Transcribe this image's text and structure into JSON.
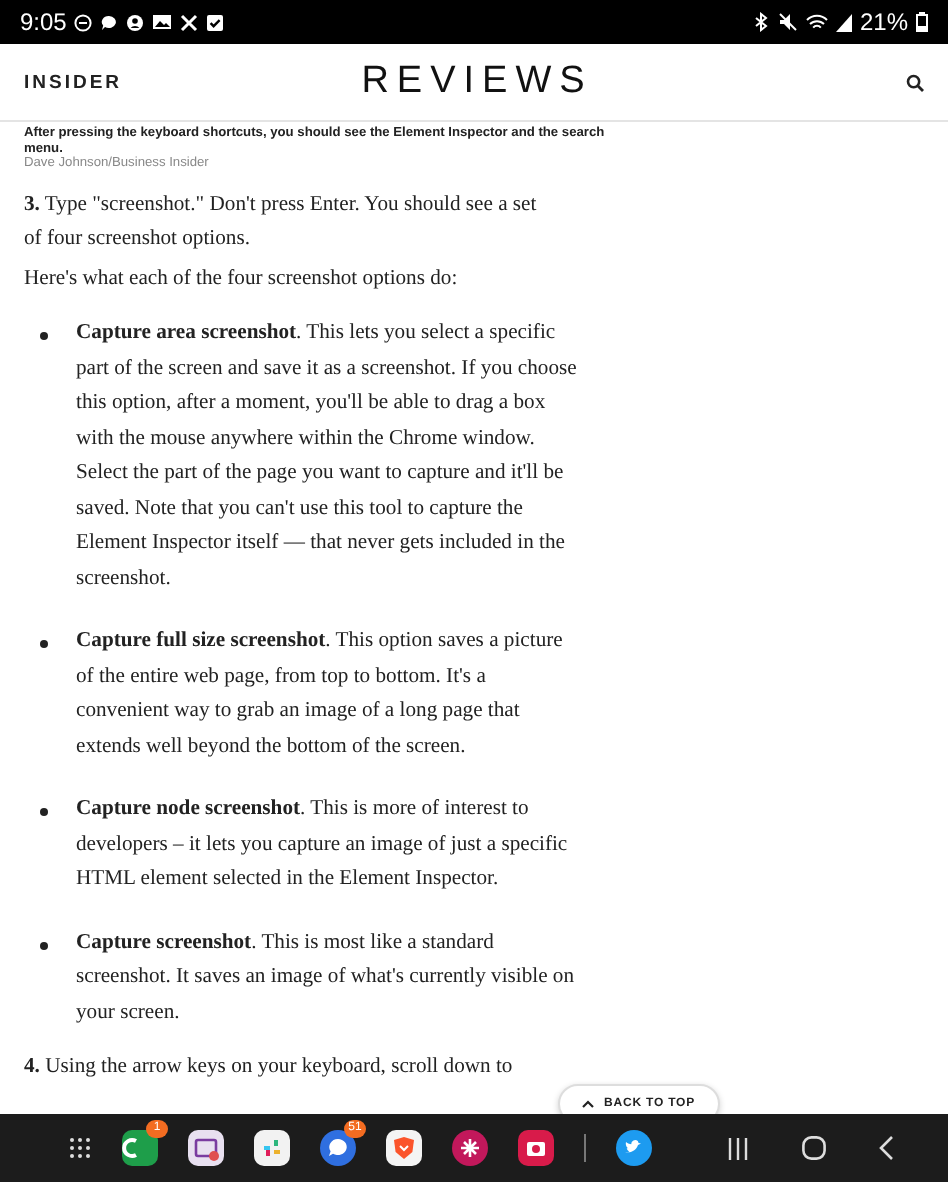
{
  "status_bar": {
    "time": "9:05",
    "battery": "21%"
  },
  "header": {
    "brand": "INSIDER",
    "title": "REVIEWS"
  },
  "caption": {
    "text": "After pressing the keyboard shortcuts, you should see the Element Inspector and the search menu.",
    "credit": "Dave Johnson/Business Insider"
  },
  "article": [
    {
      "kind": "paragraph",
      "text": "**3.** Type \"screenshot.\" Don't press Enter. You should see a set of four screenshot options."
    },
    {
      "kind": "paragraph",
      "text": "Here's what each of the four screenshot options do:"
    },
    {
      "kind": "bullet",
      "text": "**Capture area screenshot**. This lets you select a specific part of the screen and save it as a screenshot. If you choose this option, after a moment, you'll be able to drag a box with the mouse anywhere within the Chrome window. Select the part of the page you want to capture and it'll be saved. Note that you can't use this tool to capture the Element Inspector itself — that never gets included in the screenshot."
    },
    {
      "kind": "bullet",
      "text": "**Capture full size screenshot**. This option saves a picture of the entire web page, from top to bottom. It's a convenient way to grab an image of a long page that extends well beyond the bottom of the screen."
    },
    {
      "kind": "bullet",
      "text": "**Capture node screenshot**. This is more of interest to developers – it lets you capture an image of just a specific HTML element selected in the Element Inspector."
    },
    {
      "kind": "bullet",
      "text": "**Capture screenshot**. This is most like a standard screenshot. It saves an image of what's currently visible on your screen."
    },
    {
      "kind": "paragraph",
      "text": "**4.** Using the arrow keys on your keyboard, scroll down to"
    }
  ],
  "back_to_top": {
    "label": "BACK TO TOP"
  },
  "taskbar": {
    "apps": [
      {
        "kind": "phone",
        "color": "#1e9e4a",
        "badge": "1"
      },
      {
        "kind": "recorder",
        "color": "#e8e0f0"
      },
      {
        "kind": "pinwheel",
        "color": "#f2f2f2"
      },
      {
        "kind": "chat",
        "color": "#2f6fe0",
        "badge": "51"
      },
      {
        "kind": "shield",
        "color": "#f4f4f4"
      },
      {
        "kind": "flower",
        "color": "#c2185b"
      },
      {
        "kind": "camera",
        "color": "#d81b4a"
      },
      {
        "kind": "bird",
        "color": "#1d9bf0"
      }
    ]
  }
}
